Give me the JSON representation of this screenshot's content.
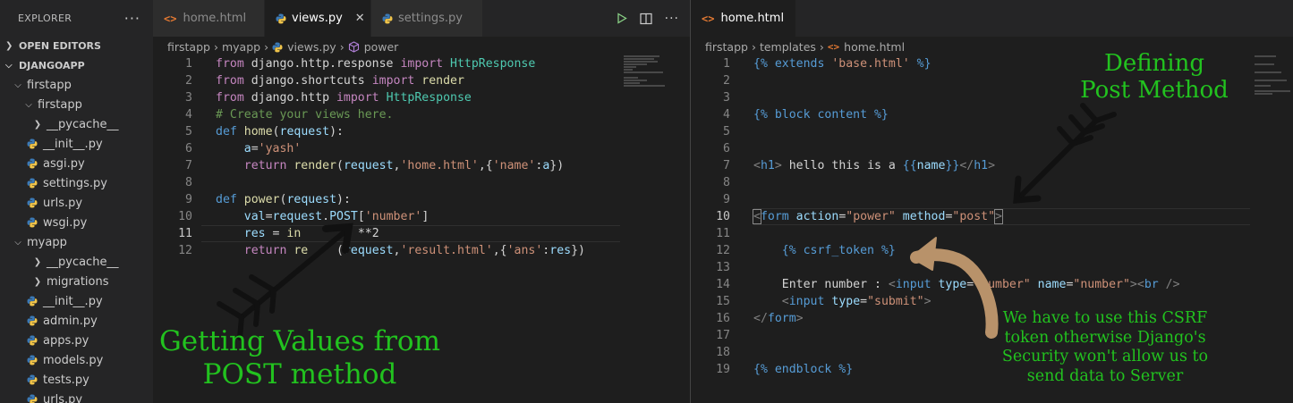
{
  "sidebar": {
    "title": "EXPLORER",
    "more": "···",
    "open_editors": "OPEN EDITORS",
    "project": "DJANGOAPP",
    "tree": [
      {
        "label": "firstapp",
        "kind": "folder-open"
      },
      {
        "label": "firstapp",
        "kind": "folder-open"
      },
      {
        "label": "__pycache__",
        "kind": "folder"
      },
      {
        "label": "__init__.py",
        "kind": "py"
      },
      {
        "label": "asgi.py",
        "kind": "py"
      },
      {
        "label": "settings.py",
        "kind": "py"
      },
      {
        "label": "urls.py",
        "kind": "py"
      },
      {
        "label": "wsgi.py",
        "kind": "py"
      },
      {
        "label": "myapp",
        "kind": "folder-open"
      },
      {
        "label": "__pycache__",
        "kind": "folder"
      },
      {
        "label": "migrations",
        "kind": "folder"
      },
      {
        "label": "__init__.py",
        "kind": "py"
      },
      {
        "label": "admin.py",
        "kind": "py"
      },
      {
        "label": "apps.py",
        "kind": "py"
      },
      {
        "label": "models.py",
        "kind": "py"
      },
      {
        "label": "tests.py",
        "kind": "py"
      },
      {
        "label": "urls.py",
        "kind": "py"
      }
    ]
  },
  "left": {
    "tabs": [
      {
        "label": "home.html",
        "icon": "html-icon",
        "active": false
      },
      {
        "label": "views.py",
        "icon": "python-icon",
        "active": true
      },
      {
        "label": "settings.py",
        "icon": "python-icon",
        "active": false
      }
    ],
    "close_glyph": "✕",
    "html_glyph": "<>",
    "breadcrumb": [
      "firstapp",
      "myapp",
      "views.py",
      "power"
    ],
    "current_line": "11",
    "line_numbers": [
      "1",
      "2",
      "3",
      "4",
      "5",
      "6",
      "7",
      "8",
      "9",
      "10",
      "11",
      "12"
    ]
  },
  "right": {
    "tab": {
      "label": "home.html",
      "icon": "html-icon"
    },
    "breadcrumb": [
      "firstapp",
      "templates",
      "home.html"
    ],
    "current_line": "10",
    "line_numbers": [
      "1",
      "2",
      "3",
      "4",
      "5",
      "6",
      "7",
      "8",
      "9",
      "10",
      "11",
      "12",
      "13",
      "14",
      "15",
      "16",
      "17",
      "18",
      "19"
    ]
  },
  "annotations": {
    "defining_l1": "Defining",
    "defining_l2": "Post Method",
    "getting_l1": "Getting Values from",
    "getting_l2": "POST method",
    "csrf_l1": "We have to use this CSRF",
    "csrf_l2": "token otherwise Django's",
    "csrf_l3": "Security won't allow us to",
    "csrf_l4": "send data to Server"
  },
  "colors": {
    "annotation_text": "#22c21f",
    "arrow_black": "#111111",
    "arrow_brown": "#b8926a",
    "python_blue": "#3b79b5",
    "python_yellow": "#f0c44a",
    "html_orange": "#e37933"
  }
}
